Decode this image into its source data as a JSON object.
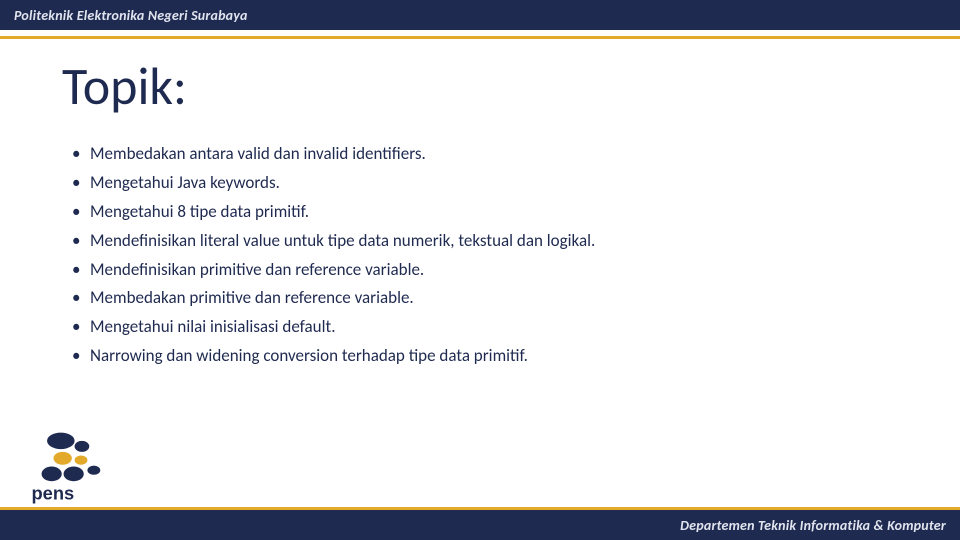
{
  "header": {
    "org_name": "Politeknik Elektronika Negeri Surabaya"
  },
  "title": "Topik:",
  "bullets": [
    "Membedakan antara valid dan invalid identifiers.",
    "Mengetahui Java keywords.",
    "Mengetahui 8 tipe data primitif.",
    "Mendefinisikan literal value untuk tipe data numerik, tekstual dan logikal.",
    "Mendefinisikan primitive dan reference variable.",
    "Membedakan primitive dan reference variable.",
    "Mengetahui nilai inisialisasi default.",
    "Narrowing dan widening conversion terhadap tipe data primitif."
  ],
  "logo": {
    "text": "pens"
  },
  "footer": {
    "dept_name": "Departemen Teknik Informatika & Komputer"
  },
  "colors": {
    "navy": "#1f2a50",
    "gold": "#e3a92a"
  }
}
